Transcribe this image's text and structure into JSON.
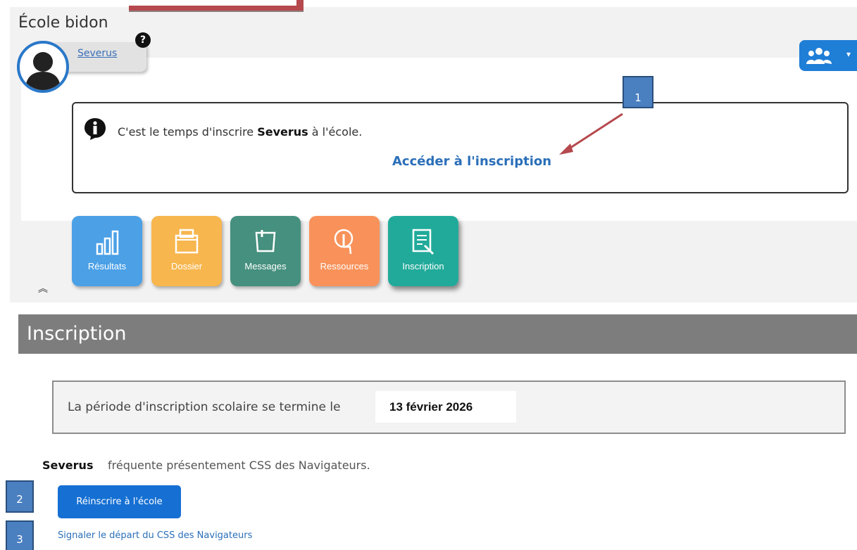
{
  "header": {
    "school_name": "École bidon",
    "user_name": "Severus",
    "help_icon": "?"
  },
  "info": {
    "message_prefix": "C'est le temps d'inscrire ",
    "student_name": "Severus",
    "message_suffix": " à l'école.",
    "link_label": "Accéder à l'inscription"
  },
  "tiles": [
    {
      "label": "Résultats",
      "icon": "bar-chart-icon"
    },
    {
      "label": "Dossier",
      "icon": "folder-icon"
    },
    {
      "label": "Messages",
      "icon": "note-icon"
    },
    {
      "label": "Ressources",
      "icon": "touch-icon"
    },
    {
      "label": "Inscription",
      "icon": "form-icon"
    }
  ],
  "section": {
    "title": "Inscription",
    "period_text": "La période d'inscription scolaire se termine le",
    "period_date": "13 février 2026",
    "attend_name": "Severus",
    "attend_text": "fréquente présentement CSS des Navigateurs.",
    "reinscribe_label": "Réinscrire à l'école",
    "depart_label": "Signaler le départ du CSS des Navigateurs"
  },
  "callouts": [
    "1",
    "2",
    "3"
  ],
  "colors": {
    "accent": "#1670d3",
    "header_bar": "#7d7d7d",
    "callout": "#4a7fc0",
    "annotation_red": "#b5494d"
  }
}
